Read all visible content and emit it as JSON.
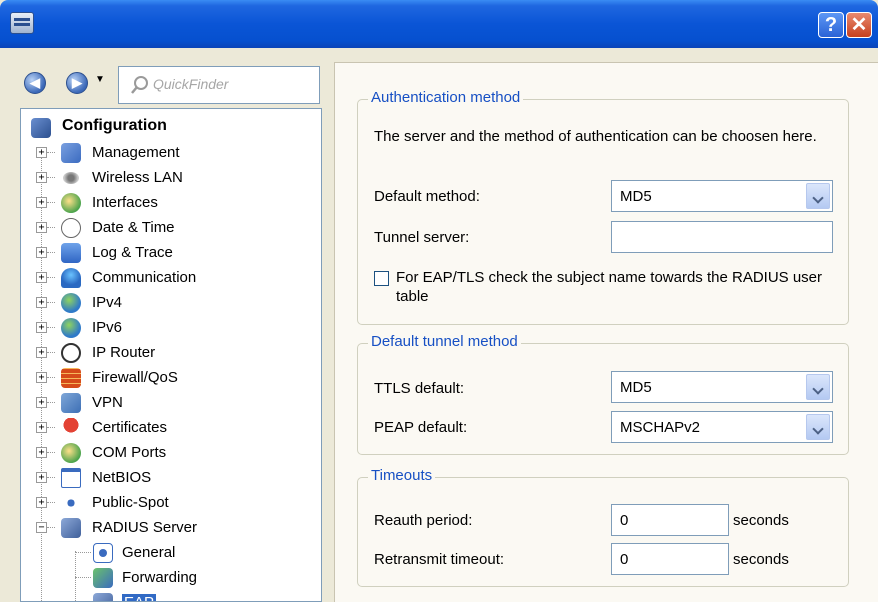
{
  "window": {
    "help_label": "?",
    "close_label": "✕"
  },
  "nav": {
    "back_glyph": "◀",
    "forward_glyph": "▶",
    "dropdown_glyph": "▼",
    "quickfinder_placeholder": "QuickFinder"
  },
  "tree": {
    "root": "Configuration",
    "items": [
      {
        "label": "Management",
        "icon": "management-icon"
      },
      {
        "label": "Wireless LAN",
        "icon": "wireless-lan-icon"
      },
      {
        "label": "Interfaces",
        "icon": "interfaces-icon"
      },
      {
        "label": "Date & Time",
        "icon": "clock-icon"
      },
      {
        "label": "Log & Trace",
        "icon": "log-icon"
      },
      {
        "label": "Communication",
        "icon": "communication-icon"
      },
      {
        "label": "IPv4",
        "icon": "ipv4-icon"
      },
      {
        "label": "IPv6",
        "icon": "ipv6-icon"
      },
      {
        "label": "IP Router",
        "icon": "router-icon"
      },
      {
        "label": "Firewall/QoS",
        "icon": "firewall-icon"
      },
      {
        "label": "VPN",
        "icon": "vpn-icon"
      },
      {
        "label": "Certificates",
        "icon": "certificate-icon"
      },
      {
        "label": "COM Ports",
        "icon": "com-ports-icon"
      },
      {
        "label": "NetBIOS",
        "icon": "netbios-icon"
      },
      {
        "label": "Public-Spot",
        "icon": "public-spot-icon"
      },
      {
        "label": "RADIUS Server",
        "icon": "radius-server-icon"
      }
    ],
    "radius_children": [
      {
        "label": "General",
        "icon": "general-icon"
      },
      {
        "label": "Forwarding",
        "icon": "forwarding-icon"
      },
      {
        "label": "EAP",
        "icon": "eap-icon"
      }
    ],
    "collapsed_glyph": "+",
    "expanded_glyph": "−"
  },
  "auth": {
    "legend": "Authentication method",
    "description": "The server and the method of authentication can be choosen here.",
    "default_method_label": "Default method:",
    "default_method_value": "MD5",
    "tunnel_server_label": "Tunnel server:",
    "tunnel_server_value": "",
    "eap_tls_check_label": "For EAP/TLS check the subject name towards the RADIUS user table",
    "eap_tls_checked": false
  },
  "tunnel": {
    "legend": "Default tunnel method",
    "ttls_label": "TTLS default:",
    "ttls_value": "MD5",
    "peap_label": "PEAP default:",
    "peap_value": "MSCHAPv2"
  },
  "timeouts": {
    "legend": "Timeouts",
    "reauth_label": "Reauth period:",
    "reauth_value": "0",
    "reauth_unit": "seconds",
    "retransmit_label": "Retransmit timeout:",
    "retransmit_value": "0",
    "retransmit_unit": "seconds"
  },
  "colors": {
    "titlebar": "#0a55d6",
    "legend_text": "#1750c4",
    "selection": "#316ac5"
  }
}
